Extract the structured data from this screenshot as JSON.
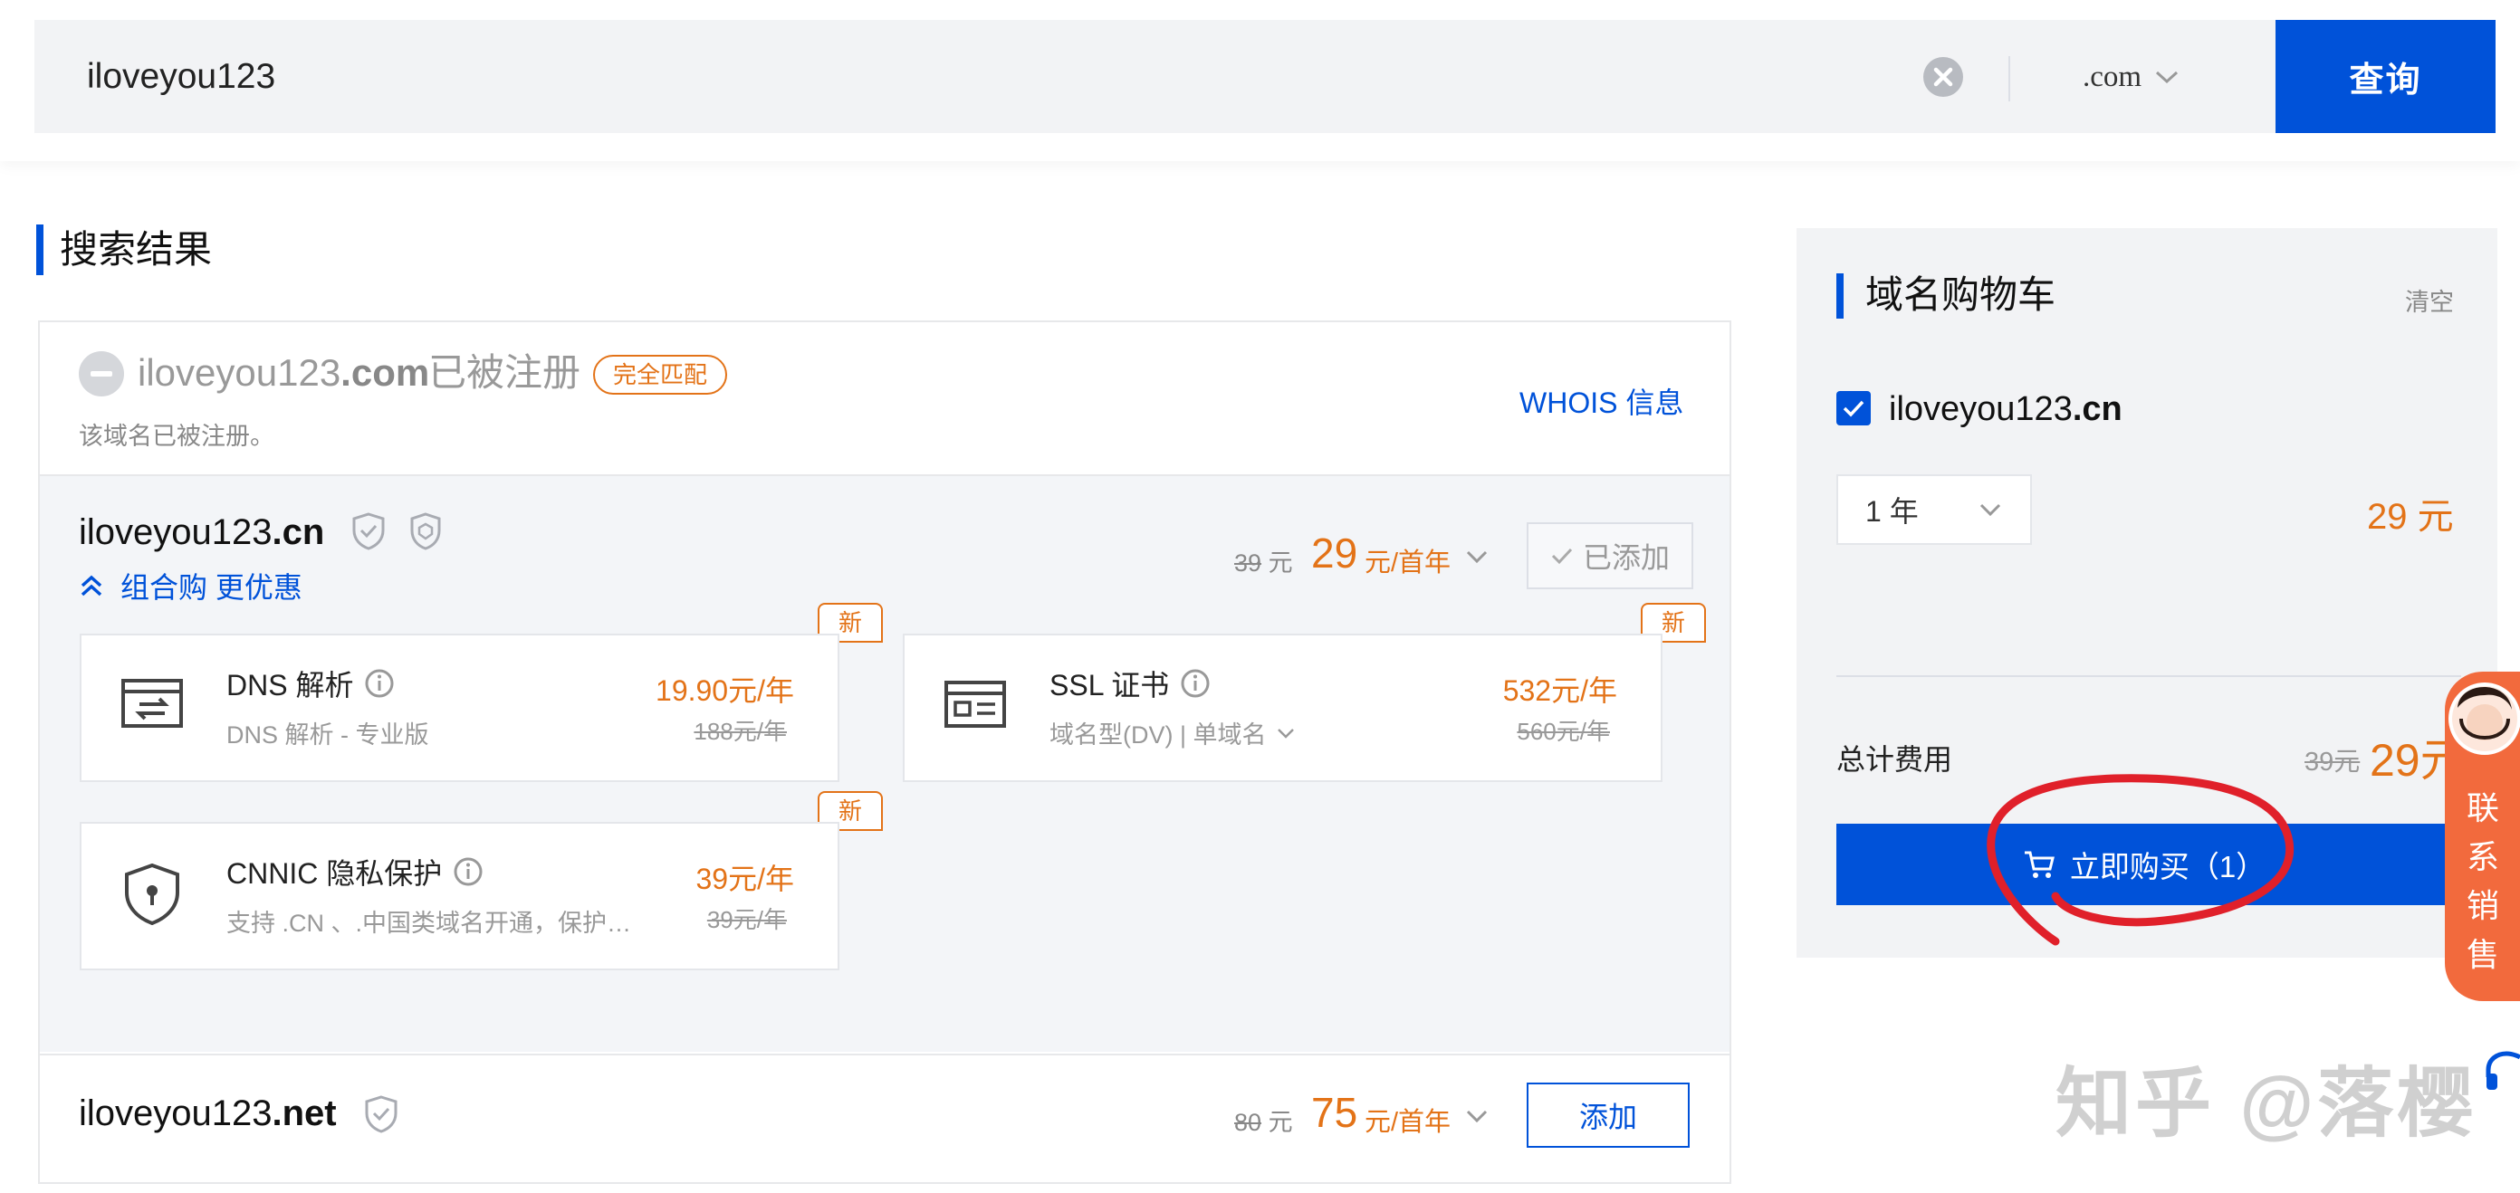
{
  "search": {
    "value": "iloveyou123",
    "suffix": ".com",
    "button_label": "查询"
  },
  "results": {
    "title": "搜索结果",
    "registered": {
      "domain_name": "iloveyou123",
      "domain_tld": ".com",
      "status": "已被注册",
      "badge": "完全匹配",
      "note": "该域名已被注册。",
      "whois_label": "WHOIS 信息"
    },
    "cn": {
      "domain_name": "iloveyou123",
      "domain_tld": ".cn",
      "combo_label": "组合购 更优惠",
      "original_price": "39",
      "original_unit": "元",
      "price": "29",
      "price_unit": "元/首年",
      "button_label": "已添加"
    },
    "services": [
      {
        "badge": "新",
        "name": "DNS 解析",
        "sub": "DNS 解析 - 专业版",
        "price": "19.90元/年",
        "old_price": "188元/年"
      },
      {
        "badge": "新",
        "name": "SSL 证书",
        "sub": "域名型(DV) | 单域名",
        "price": "532元/年",
        "old_price": "560元/年"
      },
      {
        "badge": "新",
        "name": "CNNIC 隐私保护",
        "sub": "支持 .CN 、.中国类域名开通，保护…",
        "price": "39元/年",
        "old_price": "39元/年"
      }
    ],
    "net": {
      "domain_name": "iloveyou123",
      "domain_tld": ".net",
      "original_price": "80",
      "original_unit": "元",
      "price": "75",
      "price_unit": "元/首年",
      "button_label": "添加"
    }
  },
  "cart": {
    "title": "域名购物车",
    "clear_label": "清空",
    "item_name": "iloveyou123",
    "item_tld": ".cn",
    "item_checked": true,
    "years_selected": "1 年",
    "item_price": "29 元",
    "total_label": "总计费用",
    "total_old": "39元",
    "total_price": "29元",
    "buy_label": "立即购买（1）"
  },
  "float": {
    "sales_label": "联系销售"
  },
  "watermark": "知乎 @落樱",
  "colors": {
    "primary": "#0052d9",
    "price": "#e37318",
    "annotation": "#e0202a",
    "sales_tab": "#f26a3d"
  },
  "icons": [
    "clear-icon",
    "chevron-down-icon",
    "verified-shield-icon",
    "security-shield-icon",
    "double-chevron-up-icon",
    "check-icon",
    "dns-icon",
    "ssl-certificate-icon",
    "privacy-shield-icon",
    "info-icon",
    "checkbox-icon",
    "cart-icon",
    "headset-icon"
  ]
}
